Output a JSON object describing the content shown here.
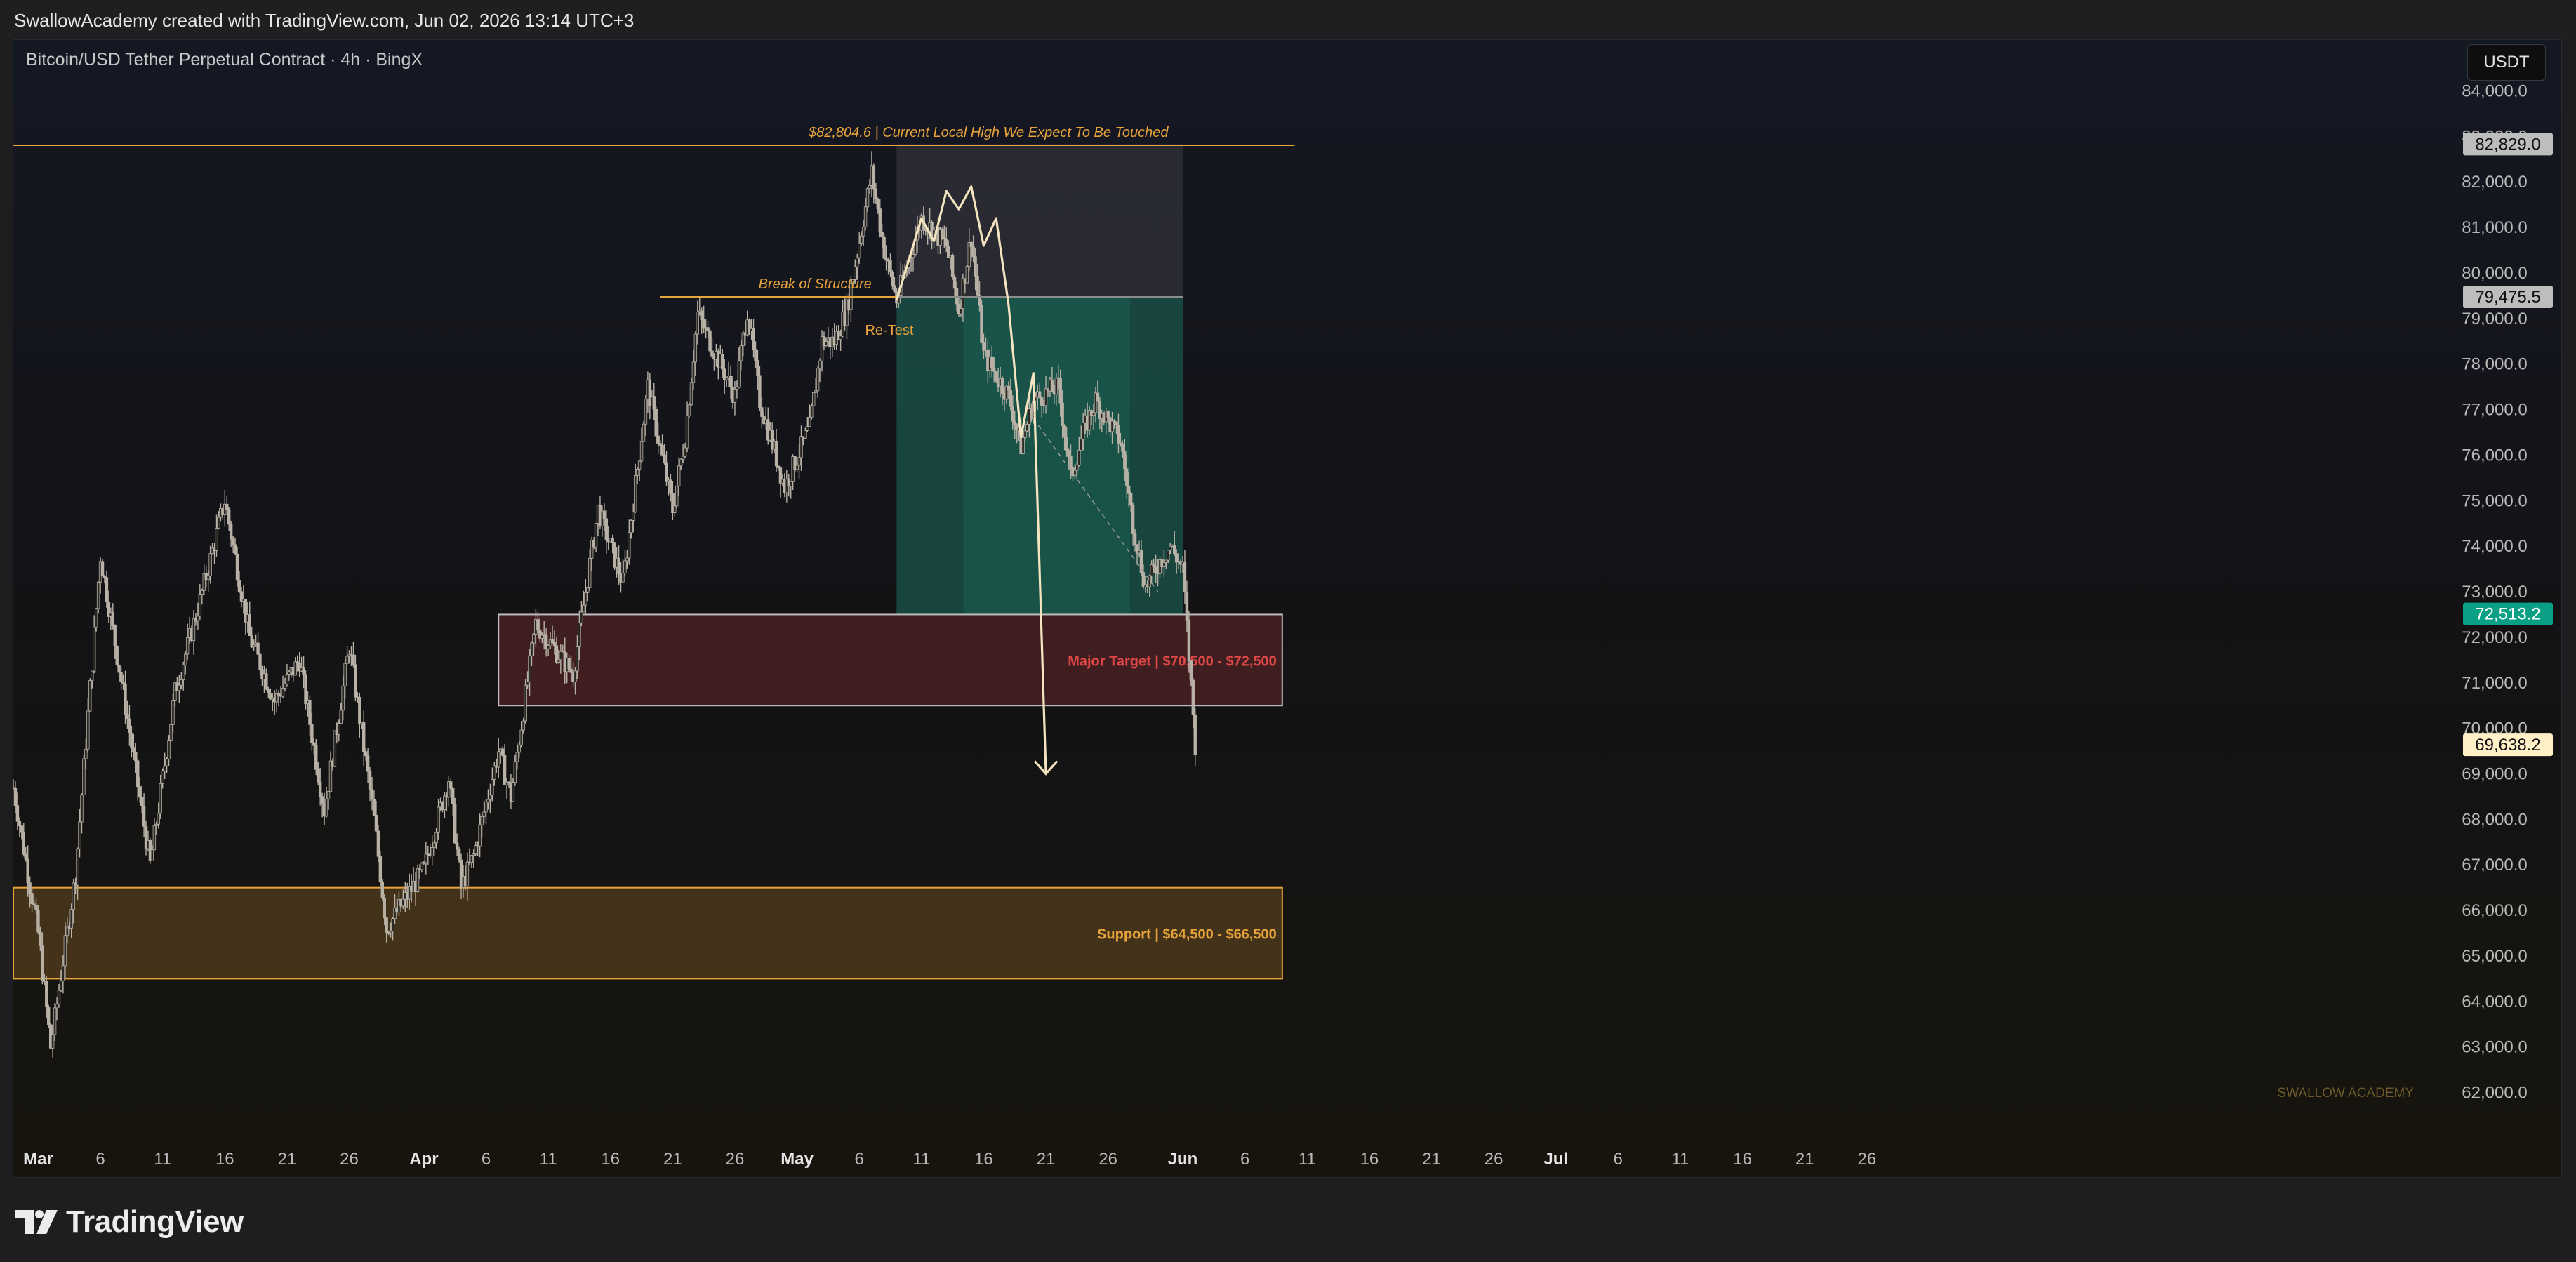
{
  "header": {
    "credit": "SwallowAcademy created with TradingView.com, Jun 02, 2026 13:14 UTC+3"
  },
  "chart": {
    "symbol_title": "Bitcoin/USD Tether Perpetual Contract · 4h · BingX",
    "currency": "USDT"
  },
  "footer": {
    "logo": "TradingView"
  },
  "colors": {
    "background": "#121214",
    "candle": "#b8b1a6",
    "resistance_line": "#e8a33a",
    "target_zone": "#e04848",
    "support_zone": "#e8a33a",
    "long_zone": "#1c6e5c",
    "projection": "#f3e4bf",
    "price_current": "#fff0c8",
    "price_green": "#0aa085",
    "price_grey": "#bdbdbd"
  },
  "chart_data": {
    "type": "candlestick",
    "timeframe": "4h",
    "x_range": [
      "2026-02-27",
      "2026-06-30"
    ],
    "x_tick_labels": [
      {
        "date": "2026-03-01",
        "label": "Mar"
      },
      {
        "date": "2026-03-06",
        "label": "6"
      },
      {
        "date": "2026-03-11",
        "label": "11"
      },
      {
        "date": "2026-03-16",
        "label": "16"
      },
      {
        "date": "2026-03-21",
        "label": "21"
      },
      {
        "date": "2026-03-26",
        "label": "26"
      },
      {
        "date": "2026-04-01",
        "label": "Apr"
      },
      {
        "date": "2026-04-06",
        "label": "6"
      },
      {
        "date": "2026-04-11",
        "label": "11"
      },
      {
        "date": "2026-04-16",
        "label": "16"
      },
      {
        "date": "2026-04-21",
        "label": "21"
      },
      {
        "date": "2026-04-26",
        "label": "26"
      },
      {
        "date": "2026-05-01",
        "label": "May"
      },
      {
        "date": "2026-05-06",
        "label": "6"
      },
      {
        "date": "2026-05-11",
        "label": "11"
      },
      {
        "date": "2026-05-16",
        "label": "16"
      },
      {
        "date": "2026-05-21",
        "label": "21"
      },
      {
        "date": "2026-05-26",
        "label": "26"
      },
      {
        "date": "2026-06-01",
        "label": "Jun"
      },
      {
        "date": "2026-06-06",
        "label": "6"
      },
      {
        "date": "2026-06-11",
        "label": "11"
      },
      {
        "date": "2026-06-16",
        "label": "16"
      },
      {
        "date": "2026-06-21",
        "label": "21"
      },
      {
        "date": "2026-06-26",
        "label": "26"
      },
      {
        "date": "2026-07-01",
        "label": "Jul"
      },
      {
        "date": "2026-07-06",
        "label": "6"
      },
      {
        "date": "2026-07-11",
        "label": "11"
      },
      {
        "date": "2026-07-16",
        "label": "16"
      },
      {
        "date": "2026-07-21",
        "label": "21"
      },
      {
        "date": "2026-07-26",
        "label": "26"
      }
    ],
    "y_range": [
      61300,
      84500
    ],
    "y_ticks": [
      62000,
      63000,
      64000,
      65000,
      66000,
      67000,
      68000,
      69000,
      70000,
      71000,
      72000,
      73000,
      74000,
      75000,
      76000,
      77000,
      78000,
      79000,
      80000,
      81000,
      82000,
      83000,
      84000
    ],
    "y_tick_labels": [
      "62,000.0",
      "63,000.0",
      "64,000.0",
      "65,000.0",
      "66,000.0",
      "67,000.0",
      "68,000.0",
      "69,000.0",
      "70,000.0",
      "71,000.0",
      "72,000.0",
      "73,000.0",
      "74,000.0",
      "75,000.0",
      "76,000.0",
      "77,000.0",
      "78,000.0",
      "79,000.0",
      "80,000.0",
      "81,000.0",
      "82,000.0",
      "83,000.0",
      "84,000.0"
    ],
    "price_path": [
      [
        "2026-02-27",
        68700
      ],
      [
        "2026-03-01",
        65500
      ],
      [
        "2026-03-02",
        63000
      ],
      [
        "2026-03-04",
        66800
      ],
      [
        "2026-03-06",
        73800
      ],
      [
        "2026-03-08",
        70500
      ],
      [
        "2026-03-10",
        67000
      ],
      [
        "2026-03-12",
        70800
      ],
      [
        "2026-03-14",
        72800
      ],
      [
        "2026-03-16",
        75000
      ],
      [
        "2026-03-18",
        72000
      ],
      [
        "2026-03-20",
        70600
      ],
      [
        "2026-03-22",
        71500
      ],
      [
        "2026-03-24",
        68200
      ],
      [
        "2026-03-26",
        71800
      ],
      [
        "2026-03-28",
        68000
      ],
      [
        "2026-03-29",
        65600
      ],
      [
        "2026-04-01",
        66900
      ],
      [
        "2026-04-03",
        68900
      ],
      [
        "2026-04-04",
        66500
      ],
      [
        "2026-04-05",
        67200
      ],
      [
        "2026-04-07",
        69500
      ],
      [
        "2026-04-08",
        68500
      ],
      [
        "2026-04-10",
        72300
      ],
      [
        "2026-04-13",
        71200
      ],
      [
        "2026-04-15",
        74800
      ],
      [
        "2026-04-17",
        73200
      ],
      [
        "2026-04-19",
        77500
      ],
      [
        "2026-04-21",
        74800
      ],
      [
        "2026-04-22",
        76400
      ],
      [
        "2026-04-23",
        79100
      ],
      [
        "2026-04-26",
        77300
      ],
      [
        "2026-04-27",
        79200
      ],
      [
        "2026-04-28",
        77200
      ],
      [
        "2026-04-30",
        75300
      ],
      [
        "2026-05-02",
        76600
      ],
      [
        "2026-05-03",
        78500
      ],
      [
        "2026-05-04",
        78500
      ],
      [
        "2026-05-05",
        79200
      ],
      [
        "2026-05-06",
        80700
      ],
      [
        "2026-05-07",
        82200
      ],
      [
        "2026-05-08",
        80500
      ],
      [
        "2026-05-09",
        79400
      ],
      [
        "2026-05-11",
        81200
      ],
      [
        "2026-05-13",
        80600
      ],
      [
        "2026-05-14",
        79200
      ],
      [
        "2026-05-15",
        80800
      ],
      [
        "2026-05-16",
        78200
      ],
      [
        "2026-05-18",
        77300
      ],
      [
        "2026-05-19",
        76200
      ],
      [
        "2026-05-20",
        77200
      ],
      [
        "2026-05-22",
        77500
      ],
      [
        "2026-05-23",
        75500
      ],
      [
        "2026-05-24",
        76500
      ],
      [
        "2026-05-25",
        77200
      ],
      [
        "2026-05-27",
        76300
      ],
      [
        "2026-05-28",
        74500
      ],
      [
        "2026-05-29",
        73100
      ],
      [
        "2026-05-30",
        73600
      ],
      [
        "2026-05-31",
        74000
      ],
      [
        "2026-06-01",
        73500
      ],
      [
        "2026-06-02",
        69638
      ]
    ],
    "annotations": [
      {
        "type": "horizontal_line",
        "label": "$82,804.6 | Current Local High We Expect To Be Touched",
        "y": 82804.6,
        "x_start": "2026-02-27",
        "x_end": "2026-06-10",
        "color": "#e8a33a"
      },
      {
        "type": "horizontal_line",
        "label": "Break of Structure",
        "y": 79475.5,
        "x_start": "2026-04-20",
        "x_end": "2026-06-01",
        "color": "#e8a33a"
      },
      {
        "type": "text",
        "label": "Re-Test",
        "x": "2026-05-07",
        "y": 78800
      },
      {
        "type": "zone",
        "label": "Major Target | $70,500 - $72,500",
        "x_start": "2026-04-07",
        "x_end": "2026-06-09",
        "y_low": 70500,
        "y_high": 72500,
        "color": "#e04848"
      },
      {
        "type": "zone",
        "label": "Support | $64,500 - $66,500",
        "x_start": "2026-02-27",
        "x_end": "2026-06-09",
        "y_low": 64500,
        "y_high": 66500,
        "color": "#e8a33a"
      },
      {
        "type": "text",
        "label": "SWALLOW ACADEMY",
        "x": "2026-07-06",
        "y": 61900
      }
    ],
    "position": {
      "entry": 79475.5,
      "stop": 82829.0,
      "target": 72513.2,
      "x_start": "2026-05-09",
      "x_end": "2026-06-01"
    },
    "projection": [
      [
        "2026-05-09",
        79400
      ],
      [
        "2026-05-11",
        81200
      ],
      [
        "2026-05-12",
        80700
      ],
      [
        "2026-05-13",
        81800
      ],
      [
        "2026-05-14",
        81400
      ],
      [
        "2026-05-15",
        81900
      ],
      [
        "2026-05-16",
        80600
      ],
      [
        "2026-05-17",
        81200
      ],
      [
        "2026-05-18",
        79300
      ],
      [
        "2026-05-19",
        76400
      ],
      [
        "2026-05-20",
        77800
      ],
      [
        "2026-05-21",
        69000
      ]
    ],
    "price_labels": [
      {
        "value": 82829.0,
        "label": "82,829.0",
        "style": "grey"
      },
      {
        "value": 79475.5,
        "label": "79,475.5",
        "style": "grey"
      },
      {
        "value": 72513.2,
        "label": "72,513.2",
        "style": "green"
      },
      {
        "value": 69638.2,
        "label": "69,638.2",
        "style": "current"
      }
    ],
    "grid": false,
    "legend": "none"
  }
}
